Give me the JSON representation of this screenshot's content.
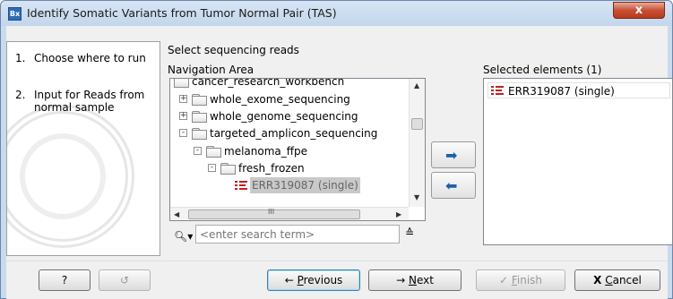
{
  "window": {
    "title": "Identify Somatic Variants from Tumor Normal Pair (TAS)",
    "app_icon_text": "Bx",
    "close_symbol": "x"
  },
  "steps": [
    {
      "number": "1.",
      "label": "Choose where to run"
    },
    {
      "number": "2.",
      "label": "Input for Reads from",
      "label_line2": "normal sample"
    }
  ],
  "main": {
    "header": "Select sequencing reads",
    "navigation_label": "Navigation Area",
    "selected_label": "Selected elements (1)"
  },
  "tree": {
    "items": [
      {
        "label": "cancer_research_workbench",
        "expander": "-",
        "type": "folder"
      },
      {
        "label": "whole_exome_sequencing",
        "expander": "+",
        "type": "folder"
      },
      {
        "label": "whole_genome_sequencing",
        "expander": "+",
        "type": "folder"
      },
      {
        "label": "targeted_amplicon_sequencing",
        "expander": "-",
        "type": "folder"
      },
      {
        "label": "melanoma_ffpe",
        "expander": "-",
        "type": "folder"
      },
      {
        "label": "fresh_frozen",
        "expander": "-",
        "type": "folder"
      },
      {
        "label": "ERR319087 (single)",
        "expander": "",
        "type": "reads",
        "selected": true
      }
    ],
    "hscroll_thumb_glyph": "III"
  },
  "search": {
    "placeholder": "<enter search term>"
  },
  "selected_elements": [
    {
      "label": "ERR319087 (single)"
    }
  ],
  "buttons": {
    "help": "?",
    "previous_arrow": "←",
    "previous_prefix": "",
    "previous_ul": "P",
    "previous_rest": "revious",
    "next_arrow": "→",
    "next_ul": "N",
    "next_rest": "ext",
    "finish_check": "✓",
    "finish_ul": "F",
    "finish_rest": "inish",
    "cancel_x": "X",
    "cancel_ul": "C",
    "cancel_rest": "ancel"
  },
  "colors": {
    "accent_blue": "#1d5fa8",
    "reads_red": "#c02020",
    "close_red": "#c75134"
  }
}
